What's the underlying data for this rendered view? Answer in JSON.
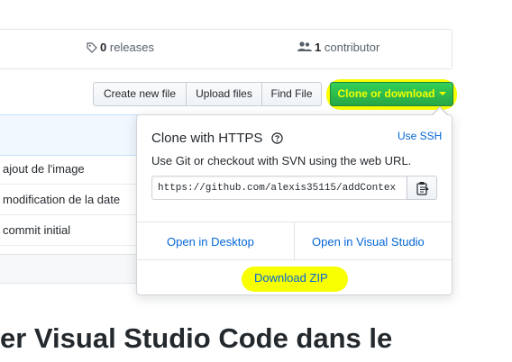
{
  "stats": {
    "releases_count": "0",
    "releases_label": "releases",
    "contributor_count": "1",
    "contributor_label": "contributor"
  },
  "toolbar": {
    "create_new_file": "Create new file",
    "upload_files": "Upload files",
    "find_file": "Find File",
    "clone_or_download": "Clone or download"
  },
  "files": {
    "rows": [
      "ajout de l'image",
      "modification de la date",
      "commit initial"
    ]
  },
  "readme": {
    "title_fragment": "er Visual Studio Code dans le"
  },
  "clone_panel": {
    "title": "Clone with HTTPS",
    "use_ssh": "Use SSH",
    "description": "Use Git or checkout with SVN using the web URL.",
    "url": "https://github.com/alexis35115/addContex",
    "open_desktop": "Open in Desktop",
    "open_visual_studio": "Open in Visual Studio",
    "download_zip": "Download ZIP"
  },
  "icons": {
    "releases": "tag-icon",
    "contributors": "people-icon",
    "help": "question-icon",
    "copy": "clipboard-icon",
    "dropdown": "caret-down-icon"
  },
  "colors": {
    "highlight": "#f7ff00",
    "clone_button": "#28a745",
    "link": "#0366d6"
  }
}
